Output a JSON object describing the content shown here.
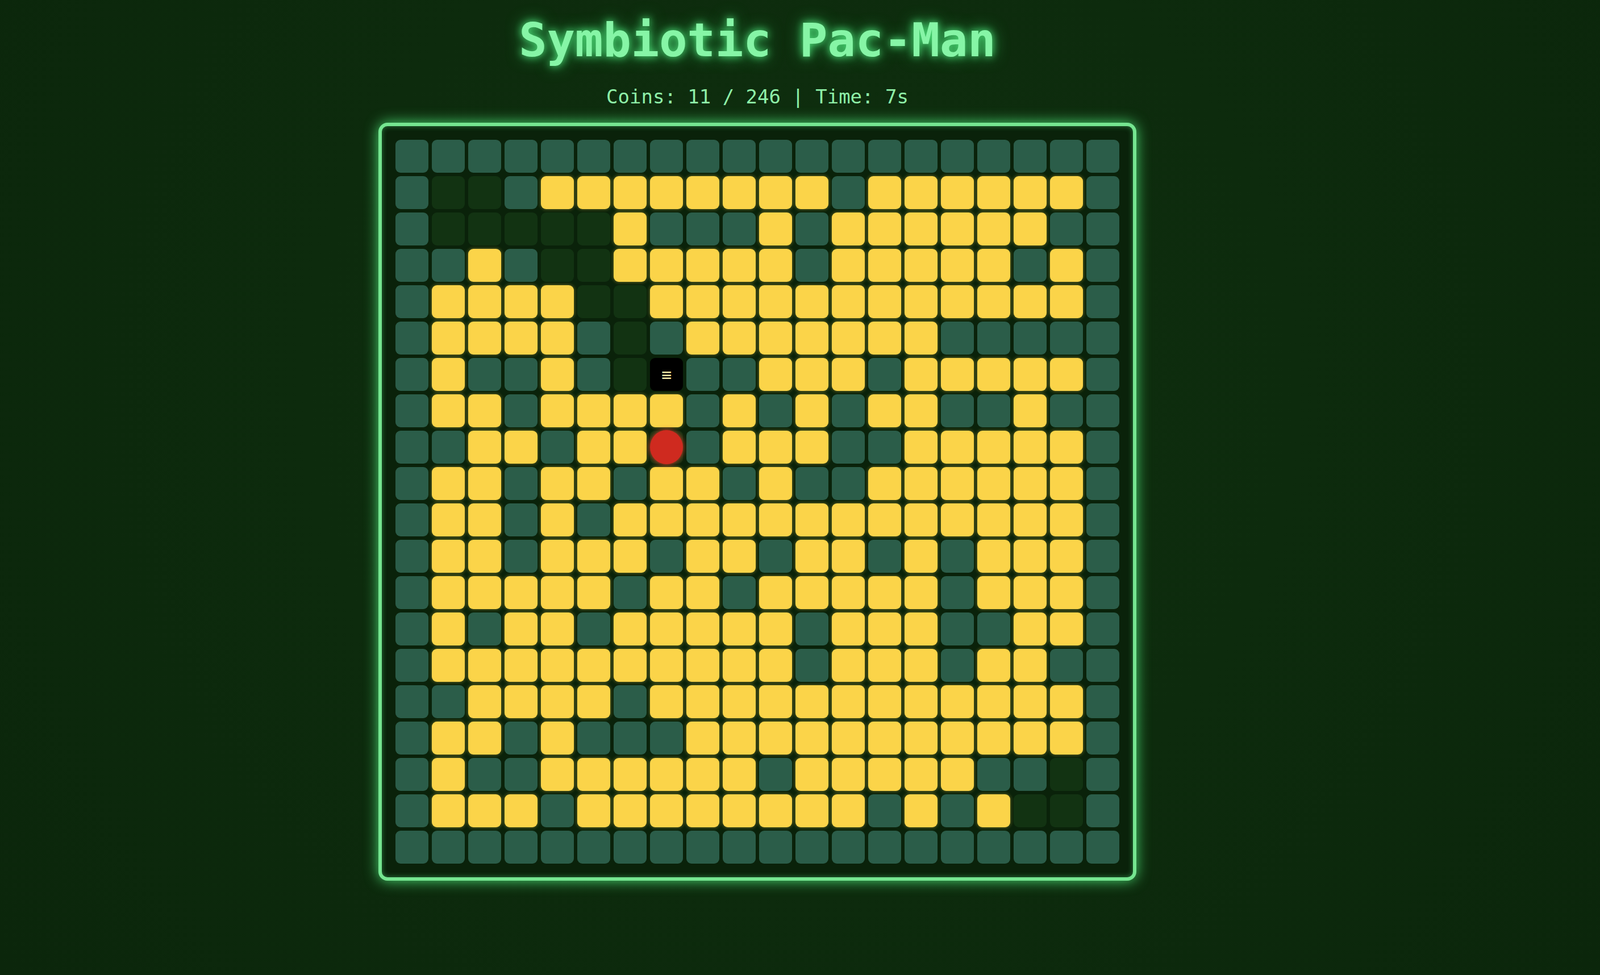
{
  "title": "Symbiotic Pac-Man",
  "status": {
    "coins_label": "Coins:",
    "coins": "11",
    "coins_total": "246",
    "separator": "|",
    "time_label": "Time:",
    "time": "7s"
  },
  "player": {
    "glyph": "≡"
  },
  "legend": {
    "W": "wall",
    "C": "coin",
    "E": "empty",
    "P": "player",
    "G": "ghost"
  },
  "grid": [
    "WWWWWWWWWWWWWWWWWWWW",
    "WEEWCCCCCCCCWCCCCCCW",
    "WEEEEECWWWCWCCCCCCWW",
    "WWCWEECCCCCWCCCCCWCW",
    "WCCCCEECCCCCCCCCCCCW",
    "WCCCCWEWCCCCCCCWWWWW",
    "WCWWCWEPWWCCCWCCCCCW",
    "WCCWCCCCWCWCWCCWWCWW",
    "WWCCWCCGWCCCWWCCCCCW",
    "WCCWCCWCCWCWWCCCCCCW",
    "WCCWCWCCCCCCCCCCCCCW",
    "WCCWCCCWCCWCCWCWCCCW",
    "WCCCCCWCCWCCCCCWCCCW",
    "WCWCCWCCCCCWCCCWWCCW",
    "WCCCCCCCCCCWCCCWCCWW",
    "WWCCCCWCCCCCCCCCCCCW",
    "WCCWCWWWCCCCCCCCCCCW",
    "WCWWCCCCCCWCCCCCWWEW",
    "WCCCWCCCCCCCCWCWCEEW",
    "WWWWWWWWWWWWWWWWWWWW"
  ]
}
